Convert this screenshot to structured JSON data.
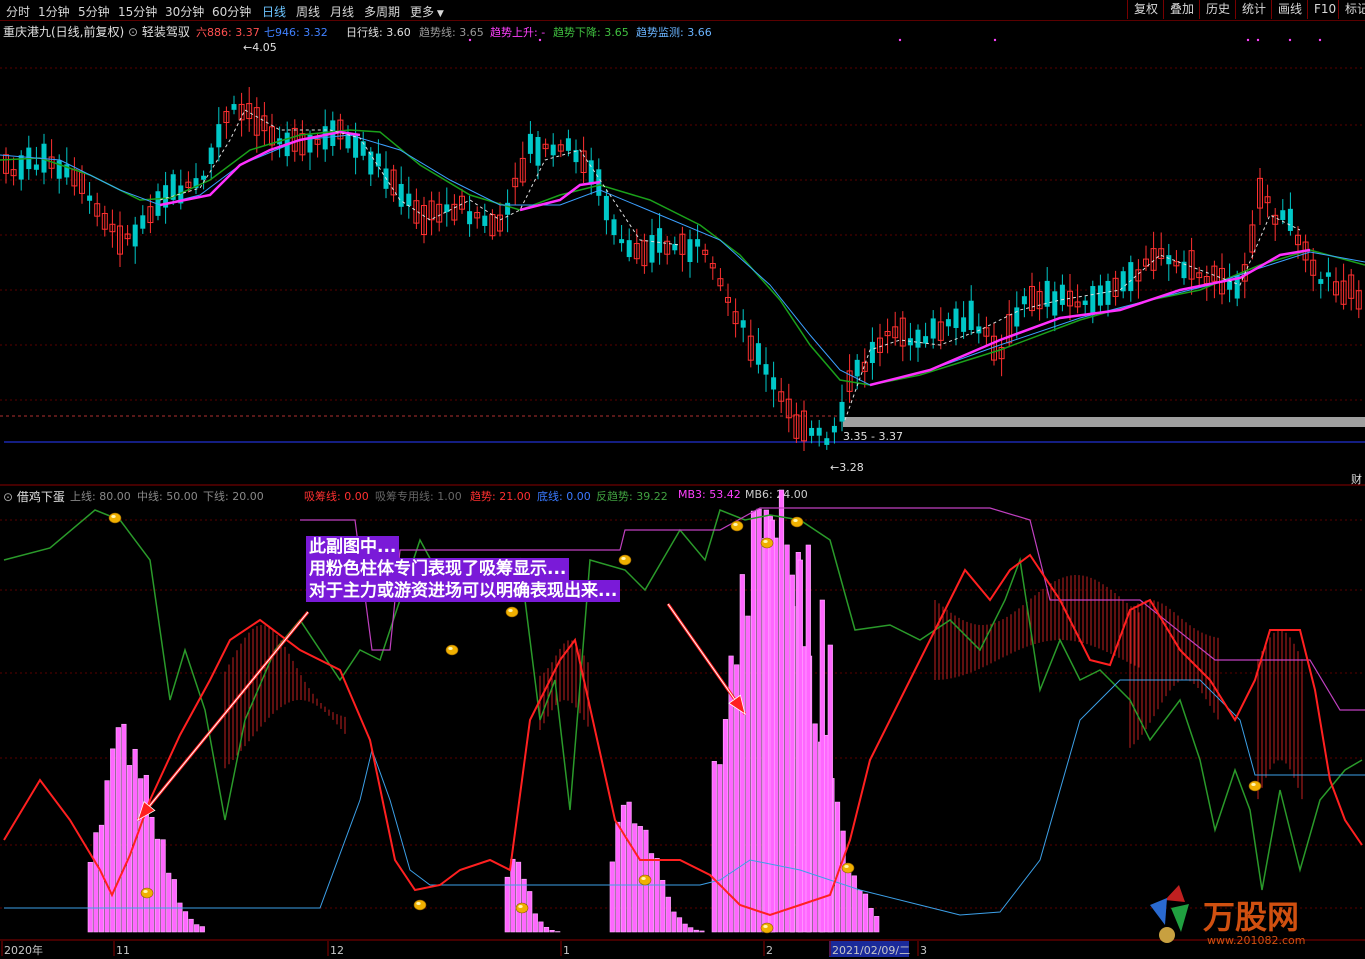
{
  "toolbar": {
    "periods": [
      "分时",
      "1分钟",
      "5分钟",
      "15分钟",
      "30分钟",
      "60分钟",
      "日线",
      "周线",
      "月线",
      "多周期",
      "更多"
    ],
    "selected": "日线",
    "right_buttons": [
      "复权",
      "叠加",
      "历史",
      "统计",
      "画线",
      "F10",
      "标记"
    ]
  },
  "main_header": {
    "stock": "重庆港九(日线,前复权)",
    "indicator_name": "轻装驾驭",
    "l886": "六886: 3.37",
    "l946": "七946: 3.32",
    "daily": "日行线: 3.60",
    "trend": "趋势线: 3.65",
    "up": "趋势上升: -",
    "down": "趋势下降: 3.65",
    "monitor": "趋势监测: 3.66"
  },
  "main_labels": {
    "high": "4.05",
    "low": "3.28",
    "range": "3.35 - 3.37",
    "side": "财"
  },
  "sub_header": {
    "name": "借鸡下蛋",
    "upper": "上线: 80.00",
    "mid": "中线: 50.00",
    "lower": "下线: 20.00",
    "xc": "吸筹线: 0.00",
    "xcz": "吸筹专用线: 1.00",
    "qs": "趋势: 21.00",
    "dx": "底线: 0.00",
    "fqs": "反趋势: 39.22",
    "mb3": "MB3: 53.42",
    "mb6": "MB6: 24.00"
  },
  "annotation": [
    "此副图中...",
    "用粉色柱体专门表现了吸筹显示...",
    "对于主力或游资进场可以明确表现出来..."
  ],
  "x_axis": {
    "labels": [
      "2020年",
      "11",
      "12",
      "1",
      "2",
      "2021/02/09/二",
      "3"
    ]
  },
  "watermark": {
    "brand": "万股网",
    "url": "www.201082.com"
  },
  "colors": {
    "up": "#ff3030",
    "down": "#00c8c8",
    "ma_magenta": "#ff30ff",
    "ma_green": "#1aa01a",
    "ma_blue": "#3ca0ff",
    "pink_bar": "#ff66ff",
    "red_line": "#ff2020",
    "green_line": "#2a9a2a",
    "blue_line": "#3ca0e8",
    "purple_line": "#c040c0"
  }
}
